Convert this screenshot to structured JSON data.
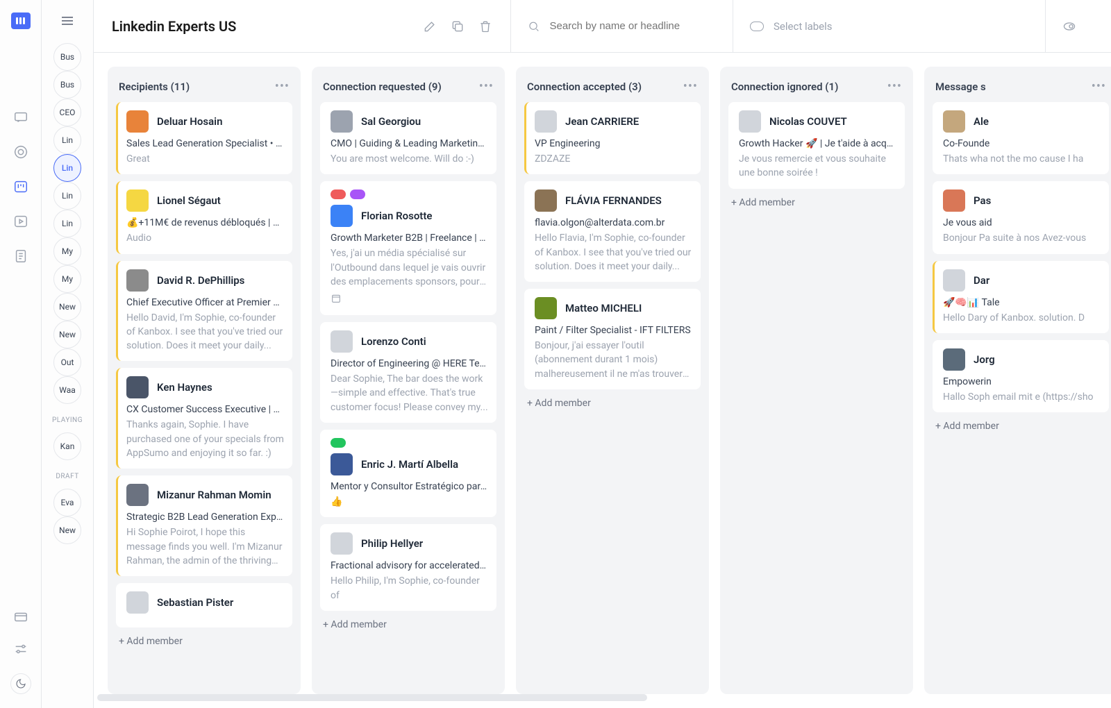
{
  "title": "Linkedin Experts US",
  "search_placeholder": "Search by name or headline",
  "labels_placeholder": "Select labels",
  "sidebar": {
    "items": [
      "Bus",
      "Bus",
      "CEO",
      "Lin",
      "Lin",
      "Lin",
      "Lin",
      "My",
      "My",
      "New",
      "New",
      "Out",
      "Waa"
    ],
    "active_index": 4,
    "section1_label": "PLAYING",
    "section1_items": [
      "Kan"
    ],
    "section2_label": "DRAFT",
    "section2_items": [
      "Eva",
      "New"
    ]
  },
  "add_member_label": "+ Add member",
  "columns": [
    {
      "title": "Recipients (11)",
      "cards": [
        {
          "name": "Deluar Hosain",
          "headline": "Sales Lead Generation Specialist • Fo...",
          "msg": "Great",
          "accent": "yellow",
          "avatar": "#e8833a"
        },
        {
          "name": "Lionel Ségaut",
          "headline": "💰+11M€ de revenus débloqués | +30...",
          "msg": "Audio",
          "accent": "yellow",
          "avatar": "#f5d742"
        },
        {
          "name": "David R. DePhillips",
          "headline": "Chief Executive Officer at Premier Ho...",
          "msg": "Hello David, I'm Sophie, co-founder of Kanbox. I see that you've tried our solution. Does it meet your daily...",
          "accent": "yellow",
          "avatar": "#8b8b8b"
        },
        {
          "name": "Ken Haynes",
          "headline": "CX Customer Success Executive | Boa...",
          "msg": "Thanks again, Sophie. I have purchased one of your specials from AppSumo and enjoying it so far. :)",
          "accent": "yellow",
          "avatar": "#4a5568"
        },
        {
          "name": "Mizanur Rahman Momin",
          "headline": "Strategic B2B Lead Generation Exper...",
          "msg": "Hi Sophie Poirot, I hope this message finds you well. I'm Mizanur Rahman, the admin of the thriving \"Saas...",
          "accent": "yellow",
          "avatar": "#6b7280"
        },
        {
          "name": "Sebastian Pister",
          "headline": "",
          "msg": "",
          "accent": "",
          "avatar": "#d1d5db"
        }
      ]
    },
    {
      "title": "Connection requested (9)",
      "cards": [
        {
          "name": "Sal Georgiou",
          "headline": "CMO | Guiding & Leading Marketing T...",
          "msg": "You are most welcome. Will do :-)",
          "accent": "",
          "avatar": "#9ca3af"
        },
        {
          "name": "Florian Rosotte",
          "headline": "Growth Marketer B2B | Freelance | H...",
          "msg": "Yes, j'ai un média spécialisé sur l'Outbound dans lequel je vais ouvrir des emplacements sponsors, pour de...",
          "accent": "",
          "avatar": "#3b82f6",
          "badges": [
            "#ef5b5b",
            "#a855f7"
          ],
          "cal": true
        },
        {
          "name": "Lorenzo Conti",
          "headline": "Director of Engineering @ HERE Tech...",
          "msg": "Dear Sophie, The bar does the work—simple and effective. That's true customer focus! Please convey my...",
          "accent": "",
          "avatar": "#d1d5db"
        },
        {
          "name": "Enric J. Martí Albella",
          "headline": "Mentor y Consultor Estratégico para ...",
          "msg": "👍",
          "accent": "",
          "avatar": "#3b5998",
          "badges": [
            "#22c55e"
          ]
        },
        {
          "name": "Philip Hellyer",
          "headline": "Fractional advisory for accelerated b...",
          "msg": "Hello Philip, I'm Sophie, co-founder of",
          "accent": "",
          "avatar": "#d1d5db"
        }
      ]
    },
    {
      "title": "Connection accepted (3)",
      "cards": [
        {
          "name": "Jean CARRIERE",
          "headline": "VP Engineering",
          "msg": "ZDZAZE",
          "accent": "yellow",
          "avatar": "#d1d5db"
        },
        {
          "name": "FLÁVIA FERNANDES",
          "headline": "flavia.olgon@alterdata.com.br",
          "msg": "Hello Flavia, I'm Sophie, co-founder of Kanbox. I see that you've tried our solution. Does it meet your daily...",
          "accent": "",
          "avatar": "#8b7355"
        },
        {
          "name": "Matteo MICHELI",
          "headline": "Paint / Filter Specialist - IFT FILTERS",
          "msg": "Bonjour, j'ai essayer l'outil (abonnement durant 1 mois) malhereusement il ne m'as trouver 0...",
          "accent": "",
          "avatar": "#6b8e23"
        }
      ]
    },
    {
      "title": "Connection ignored (1)",
      "cards": [
        {
          "name": "Nicolas COUVET",
          "headline": "Growth Hacker 🚀 | Je t'aide à acquéri...",
          "msg": "Je vous remercie et vous souhaite une bonne soirée !",
          "accent": "",
          "avatar": "#d1d5db"
        }
      ]
    },
    {
      "title": "Message s",
      "cards": [
        {
          "name": "Ale",
          "headline": "Co-Founde",
          "msg": "Thats wha not the mo cause I ha",
          "accent": "",
          "avatar": "#c4a77d"
        },
        {
          "name": "Pas",
          "headline": "Je vous aid",
          "msg": "Bonjour Pa suite à nos Avez-vous",
          "accent": "",
          "avatar": "#d97757"
        },
        {
          "name": "Dar",
          "headline": "🚀🧠📊 Tale",
          "msg": "Hello Dary of Kanbox. solution. D",
          "accent": "yellow",
          "avatar": "#d1d5db"
        },
        {
          "name": "Jorg",
          "headline": "Empowerin",
          "msg": "Hallo Soph email mit e (https://sho",
          "accent": "",
          "avatar": "#5b6b7a"
        }
      ]
    }
  ]
}
